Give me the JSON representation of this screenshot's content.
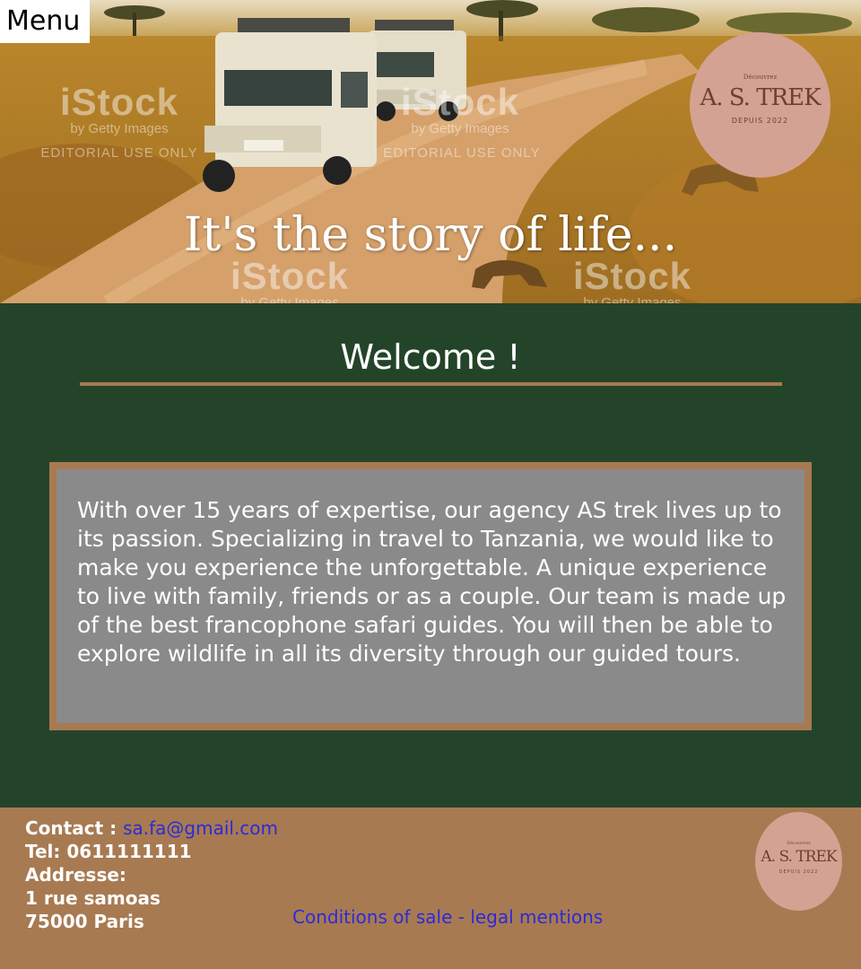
{
  "nav": {
    "menu_label": "Menu"
  },
  "hero": {
    "tagline": "It's the story of life...",
    "watermark": {
      "brand": "iStock",
      "byline": "by Getty Images",
      "notice": "EDITORIAL USE ONLY"
    }
  },
  "brand_logo": {
    "top_text": "Découvrez",
    "name": "A. S. TREK",
    "since": "DEPUIS 2022"
  },
  "welcome": {
    "title": "Welcome !",
    "body": "With over 15 years of expertise, our agency AS trek lives up to its passion. Specializing in travel to Tanzania, we would like to make you experience the unforgettable. A unique experience to live with family, friends or as a couple. Our team is made up of the best francophone safari guides. You will then be able to explore wildlife in all its diversity through our guided tours."
  },
  "footer": {
    "contact_label": "Contact :",
    "email": "sa.fa@gmail.com",
    "tel": "Tel: 0611111111",
    "address_label": "Addresse:",
    "address_line1": "1 rue samoas",
    "address_line2": "75000 Paris",
    "legal_link": "Conditions of sale - legal mentions"
  },
  "colors": {
    "main_bg": "#24442a",
    "accent_brown": "#a87a52",
    "box_gray": "#8a8a8a",
    "logo_pink": "#d4a292",
    "link_blue": "#2b2bd6"
  }
}
